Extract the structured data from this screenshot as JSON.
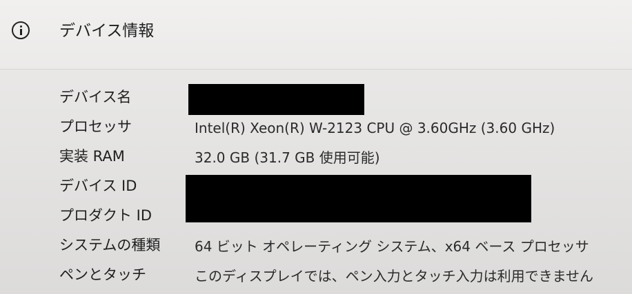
{
  "section": {
    "title": "デバイス情報",
    "icon": "info-icon"
  },
  "rows": [
    {
      "label": "デバイス名",
      "value": ""
    },
    {
      "label": "プロセッサ",
      "value": "Intel(R) Xeon(R) W-2123 CPU @ 3.60GHz (3.60 GHz)"
    },
    {
      "label": "実装 RAM",
      "value": "32.0 GB (31.7 GB 使用可能)"
    },
    {
      "label": "デバイス ID",
      "value": ""
    },
    {
      "label": "プロダクト ID",
      "value": ""
    },
    {
      "label": "システムの種類",
      "value": "64 ビット オペレーティング システム、x64 ベース プロセッサ"
    },
    {
      "label": "ペンとタッチ",
      "value": "このディスプレイでは、ペン入力とタッチ入力は利用できません"
    }
  ],
  "colors": {
    "background": "#e6e5e4",
    "text": "#1f1f1f",
    "redaction": "#000000"
  }
}
